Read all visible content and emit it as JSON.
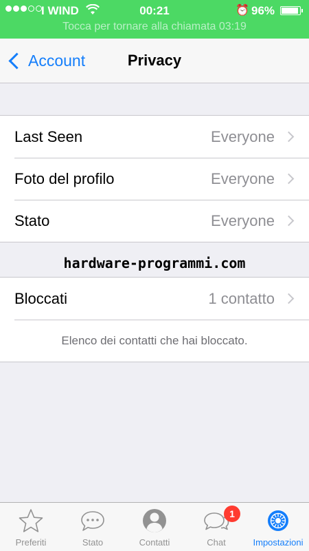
{
  "status_bar": {
    "carrier": "I WIND",
    "time": "00:21",
    "battery_text": "96%",
    "battery_level": 0.96,
    "call_banner": "Tocca per tornare alla chiamata  03:19",
    "color": "#4cd964"
  },
  "nav": {
    "back_label": "Account",
    "title": "Privacy"
  },
  "visibility_group": [
    {
      "label": "Last Seen",
      "value": "Everyone"
    },
    {
      "label": "Foto del profilo",
      "value": "Everyone"
    },
    {
      "label": "Stato",
      "value": "Everyone"
    }
  ],
  "watermark": "hardware-programmi.com",
  "blocked_group": {
    "label": "Bloccati",
    "value": "1 contatto",
    "note": "Elenco dei contatti che hai bloccato."
  },
  "tabbar": {
    "items": [
      {
        "label": "Preferiti",
        "icon": "star-icon"
      },
      {
        "label": "Stato",
        "icon": "speech-bubble-icon"
      },
      {
        "label": "Contatti",
        "icon": "contact-icon"
      },
      {
        "label": "Chat",
        "icon": "chat-bubbles-icon",
        "badge": "1"
      },
      {
        "label": "Impostazioni",
        "icon": "gear-icon"
      }
    ],
    "active": "Impostazioni",
    "accent": "#147efb"
  }
}
